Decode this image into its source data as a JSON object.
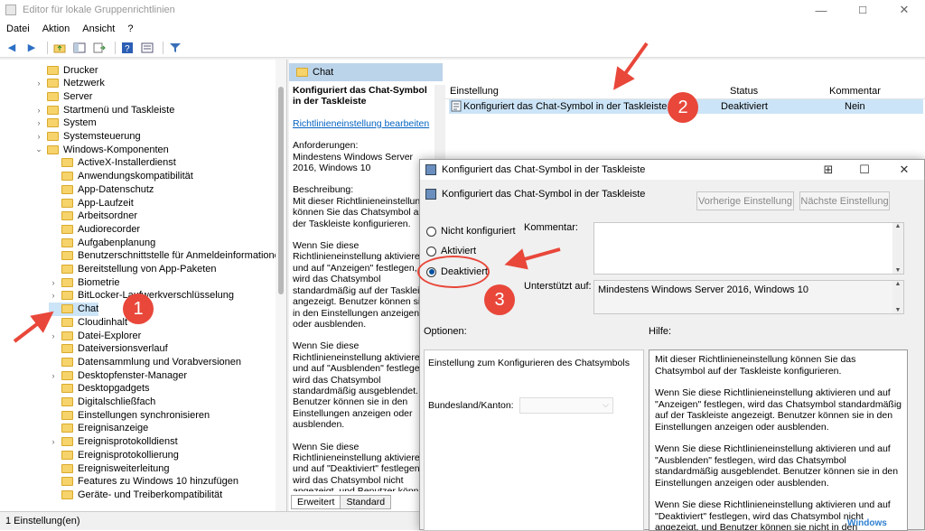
{
  "window": {
    "title": "Editor für lokale Gruppenrichtlinien",
    "minimize": "—",
    "maximize": "☐",
    "close": "✕"
  },
  "menu": [
    "Datei",
    "Aktion",
    "Ansicht",
    "?"
  ],
  "tree": {
    "items": [
      {
        "label": "Drucker",
        "exp": ""
      },
      {
        "label": "Netzwerk",
        "exp": "›"
      },
      {
        "label": "Server",
        "exp": ""
      },
      {
        "label": "Startmenü und Taskleiste",
        "exp": "›"
      },
      {
        "label": "System",
        "exp": "›"
      },
      {
        "label": "Systemsteuerung",
        "exp": "›"
      },
      {
        "label": "Windows-Komponenten",
        "exp": "⌄"
      }
    ],
    "children": [
      {
        "label": "ActiveX-Installerdienst",
        "exp": ""
      },
      {
        "label": "Anwendungskompatibilität",
        "exp": ""
      },
      {
        "label": "App-Datenschutz",
        "exp": ""
      },
      {
        "label": "App-Laufzeit",
        "exp": ""
      },
      {
        "label": "Arbeitsordner",
        "exp": ""
      },
      {
        "label": "Audiorecorder",
        "exp": ""
      },
      {
        "label": "Aufgabenplanung",
        "exp": ""
      },
      {
        "label": "Benutzerschnittstelle für Anmeldeinformationen",
        "exp": ""
      },
      {
        "label": "Bereitstellung von App-Paketen",
        "exp": ""
      },
      {
        "label": "Biometrie",
        "exp": "›"
      },
      {
        "label": "BitLocker-Laufwerkverschlüsselung",
        "exp": "›"
      },
      {
        "label": "Chat",
        "exp": ""
      },
      {
        "label": "Cloudinhalt",
        "exp": ""
      },
      {
        "label": "Datei-Explorer",
        "exp": "›"
      },
      {
        "label": "Dateiversionsverlauf",
        "exp": ""
      },
      {
        "label": "Datensammlung und Vorabversionen",
        "exp": ""
      },
      {
        "label": "Desktopfenster-Manager",
        "exp": "›"
      },
      {
        "label": "Desktopgadgets",
        "exp": ""
      },
      {
        "label": "Digitalschließfach",
        "exp": ""
      },
      {
        "label": "Einstellungen synchronisieren",
        "exp": ""
      },
      {
        "label": "Ereignisanzeige",
        "exp": ""
      },
      {
        "label": "Ereignisprotokolldienst",
        "exp": "›"
      },
      {
        "label": "Ereignisprotokollierung",
        "exp": ""
      },
      {
        "label": "Ereignisweiterleitung",
        "exp": ""
      },
      {
        "label": "Features zu Windows 10 hinzufügen",
        "exp": ""
      },
      {
        "label": "Geräte- und Treiberkompatibilität",
        "exp": ""
      }
    ]
  },
  "chat_header": "Chat",
  "description": {
    "title": "Konfiguriert das Chat-Symbol in der Taskleiste",
    "edit_link": "Richtlinieneinstellung bearbeiten",
    "requirements": "Anforderungen:\nMindestens Windows Server 2016, Windows 10",
    "description": "Beschreibung:\nMit dieser Richtlinieneinstellung können Sie das Chatsymbol auf der Taskleiste konfigurieren.",
    "p1": "Wenn Sie diese Richtlinieneinstellung aktivieren und auf \"Anzeigen\" festlegen, wird das Chatsymbol standardmäßig auf der Taskleiste angezeigt. Benutzer können sie in den Einstellungen anzeigen oder ausblenden.",
    "p2": "Wenn Sie diese Richtlinieneinstellung aktivieren und auf \"Ausblenden\" festlegen, wird das Chatsymbol standardmäßig ausgeblendet. Benutzer können sie in den Einstellungen anzeigen oder ausblenden.",
    "p3": "Wenn Sie diese Richtlinieneinstellung aktivieren und auf \"Deaktiviert\" festlegen, wird das Chatsymbol nicht angezeigt, und Benutzer können"
  },
  "tabs": [
    "Erweitert",
    "Standard"
  ],
  "list": {
    "headers": {
      "setting": "Einstellung",
      "status": "Status",
      "comment": "Kommentar"
    },
    "row": {
      "setting": "Konfiguriert das Chat-Symbol in der Taskleiste",
      "status": "Deaktiviert",
      "comment": "Nein"
    }
  },
  "statusbar": "1 Einstellung(en)",
  "dialog": {
    "title": "Konfiguriert das Chat-Symbol in der Taskleiste",
    "subtitle": "Konfiguriert das Chat-Symbol in der Taskleiste",
    "btn_prev": "Vorherige Einstellung",
    "btn_next": "Nächste Einstellung",
    "radio_nc": "Nicht konfiguriert",
    "radio_on": "Aktiviert",
    "radio_off": "Deaktiviert",
    "comment_label": "Kommentar:",
    "supported_label": "Unterstützt auf:",
    "supported_value": "Mindestens Windows Server 2016, Windows 10",
    "options_label": "Optionen:",
    "help_label": "Hilfe:",
    "options_text": "Einstellung zum Konfigurieren des Chatsymbols",
    "state_label": "Bundesland/Kanton:",
    "help1": "Mit dieser Richtlinieneinstellung können Sie das Chatsymbol auf der Taskleiste konfigurieren.",
    "help2": "Wenn Sie diese Richtlinieneinstellung aktivieren und auf \"Anzeigen\" festlegen, wird das Chatsymbol standardmäßig auf der Taskleiste angezeigt. Benutzer können sie in den Einstellungen anzeigen oder ausblenden.",
    "help3": "Wenn Sie diese Richtlinieneinstellung aktivieren und auf \"Ausblenden\" festlegen, wird das Chatsymbol standardmäßig ausgeblendet. Benutzer können sie in den Einstellungen anzeigen oder ausblenden.",
    "help4": "Wenn Sie diese Richtlinieneinstellung aktivieren und auf \"Deaktiviert\" festlegen, wird das Chatsymbol nicht angezeigt, und Benutzer können sie nicht in den Einstellungen"
  },
  "annotations": {
    "b1": "1",
    "b2": "2",
    "b3": "3",
    "color": "#e8473a"
  },
  "watermark": "Windows"
}
